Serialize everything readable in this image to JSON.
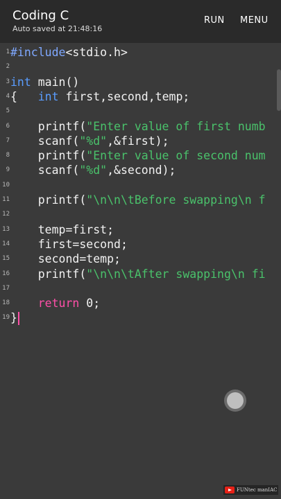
{
  "app": {
    "title": "Coding C",
    "subtitle": "Auto saved at 21:48:16",
    "run_label": "RUN",
    "menu_label": "MENU"
  },
  "editor": {
    "lines": [
      {
        "n": "1",
        "tokens": [
          {
            "t": "#include",
            "c": "pp"
          },
          {
            "t": "<stdio.h>",
            "c": ""
          }
        ]
      },
      {
        "n": "2",
        "tokens": []
      },
      {
        "n": "3",
        "tokens": [
          {
            "t": "int",
            "c": "kw"
          },
          {
            "t": " main()",
            "c": ""
          }
        ]
      },
      {
        "n": "4",
        "tokens": [
          {
            "t": "{   ",
            "c": ""
          },
          {
            "t": "int",
            "c": "kw"
          },
          {
            "t": " first,second,temp;",
            "c": ""
          }
        ]
      },
      {
        "n": "5",
        "tokens": []
      },
      {
        "n": "6",
        "tokens": [
          {
            "t": "    printf(",
            "c": ""
          },
          {
            "t": "\"Enter value of first numb",
            "c": "str"
          }
        ]
      },
      {
        "n": "7",
        "tokens": [
          {
            "t": "    scanf(",
            "c": ""
          },
          {
            "t": "\"%d\"",
            "c": "str"
          },
          {
            "t": ",&first);",
            "c": ""
          }
        ]
      },
      {
        "n": "8",
        "tokens": [
          {
            "t": "    printf(",
            "c": ""
          },
          {
            "t": "\"Enter value of second num",
            "c": "str"
          }
        ]
      },
      {
        "n": "9",
        "tokens": [
          {
            "t": "    scanf(",
            "c": ""
          },
          {
            "t": "\"%d\"",
            "c": "str"
          },
          {
            "t": ",&second);",
            "c": ""
          }
        ]
      },
      {
        "n": "10",
        "tokens": []
      },
      {
        "n": "11",
        "tokens": [
          {
            "t": "    printf(",
            "c": ""
          },
          {
            "t": "\"\\n\\n\\tBefore swapping\\n f",
            "c": "str"
          }
        ]
      },
      {
        "n": "12",
        "tokens": []
      },
      {
        "n": "13",
        "tokens": [
          {
            "t": "    temp=first;",
            "c": ""
          }
        ]
      },
      {
        "n": "14",
        "tokens": [
          {
            "t": "    first=second;",
            "c": ""
          }
        ]
      },
      {
        "n": "15",
        "tokens": [
          {
            "t": "    second=temp;",
            "c": ""
          }
        ]
      },
      {
        "n": "16",
        "tokens": [
          {
            "t": "    printf(",
            "c": ""
          },
          {
            "t": "\"\\n\\n\\tAfter swapping\\n fi",
            "c": "str"
          }
        ]
      },
      {
        "n": "17",
        "tokens": []
      },
      {
        "n": "18",
        "tokens": [
          {
            "t": "    ",
            "c": ""
          },
          {
            "t": "return",
            "c": "ret"
          },
          {
            "t": " 0;",
            "c": ""
          }
        ]
      },
      {
        "n": "19",
        "tokens": [
          {
            "t": "}",
            "c": ""
          }
        ],
        "cursor": true
      }
    ]
  },
  "watermark": {
    "icon": "youtube-play-icon",
    "text": "FUNtec manIAC"
  },
  "colors": {
    "background": "#3a3a3a",
    "appbar": "#2a2a2a",
    "preprocessor": "#7fa8ff",
    "keyword": "#5a9dff",
    "string": "#4ac26b",
    "return_keyword": "#ff4fa8"
  }
}
